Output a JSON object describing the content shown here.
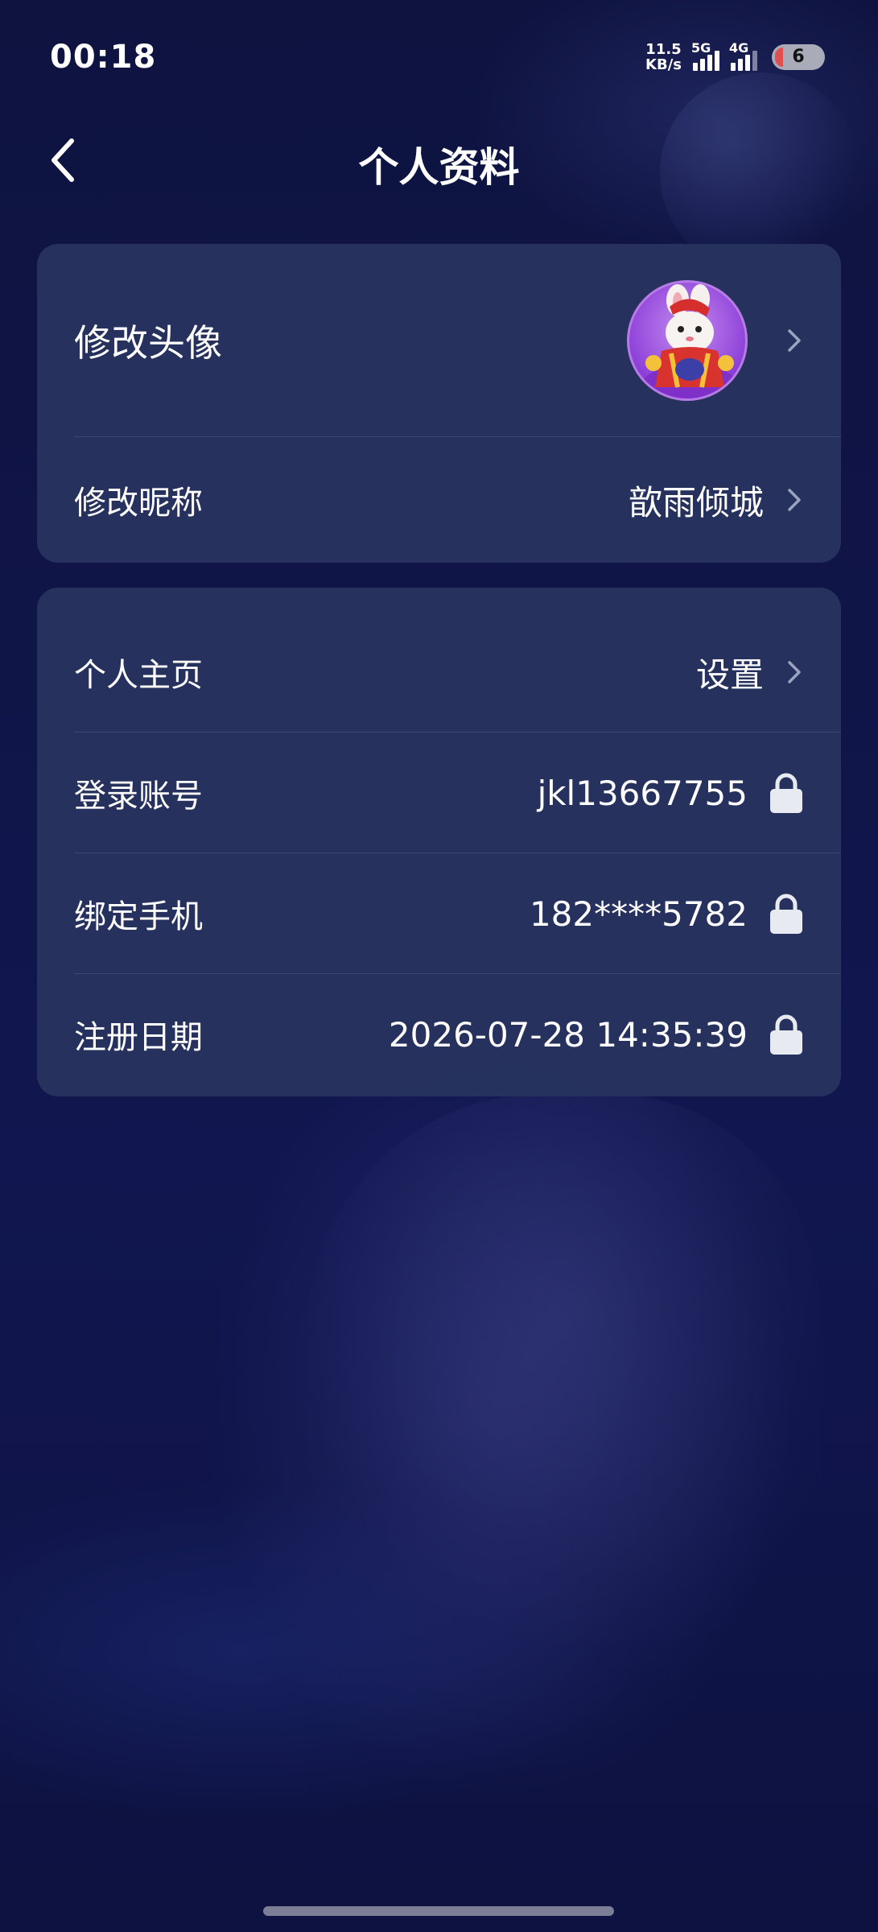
{
  "status_bar": {
    "time": "00:18",
    "net_speed_value": "11.5",
    "net_speed_unit": "KB/s",
    "sim1_label": "5G",
    "sim2_label": "4G",
    "battery_level": "6"
  },
  "header": {
    "title": "个人资料",
    "back_icon": "chevron-left-icon"
  },
  "profile_card": {
    "avatar_row_label": "修改头像",
    "nickname_row_label": "修改昵称",
    "nickname_value": "歆雨倾城"
  },
  "account_card": {
    "homepage_label": "个人主页",
    "homepage_value": "设置",
    "login_label": "登录账号",
    "login_value": "jkl13667755",
    "phone_label": "绑定手机",
    "phone_value": "182****5782",
    "register_label": "注册日期",
    "register_value": "2026-07-28 14:35:39"
  },
  "icons": {
    "chevron": "chevron-right-icon",
    "lock": "lock-icon"
  },
  "colors": {
    "card_bg": "#28345f",
    "page_bg": "#101548",
    "avatar_accent": "#8c3fd8"
  }
}
